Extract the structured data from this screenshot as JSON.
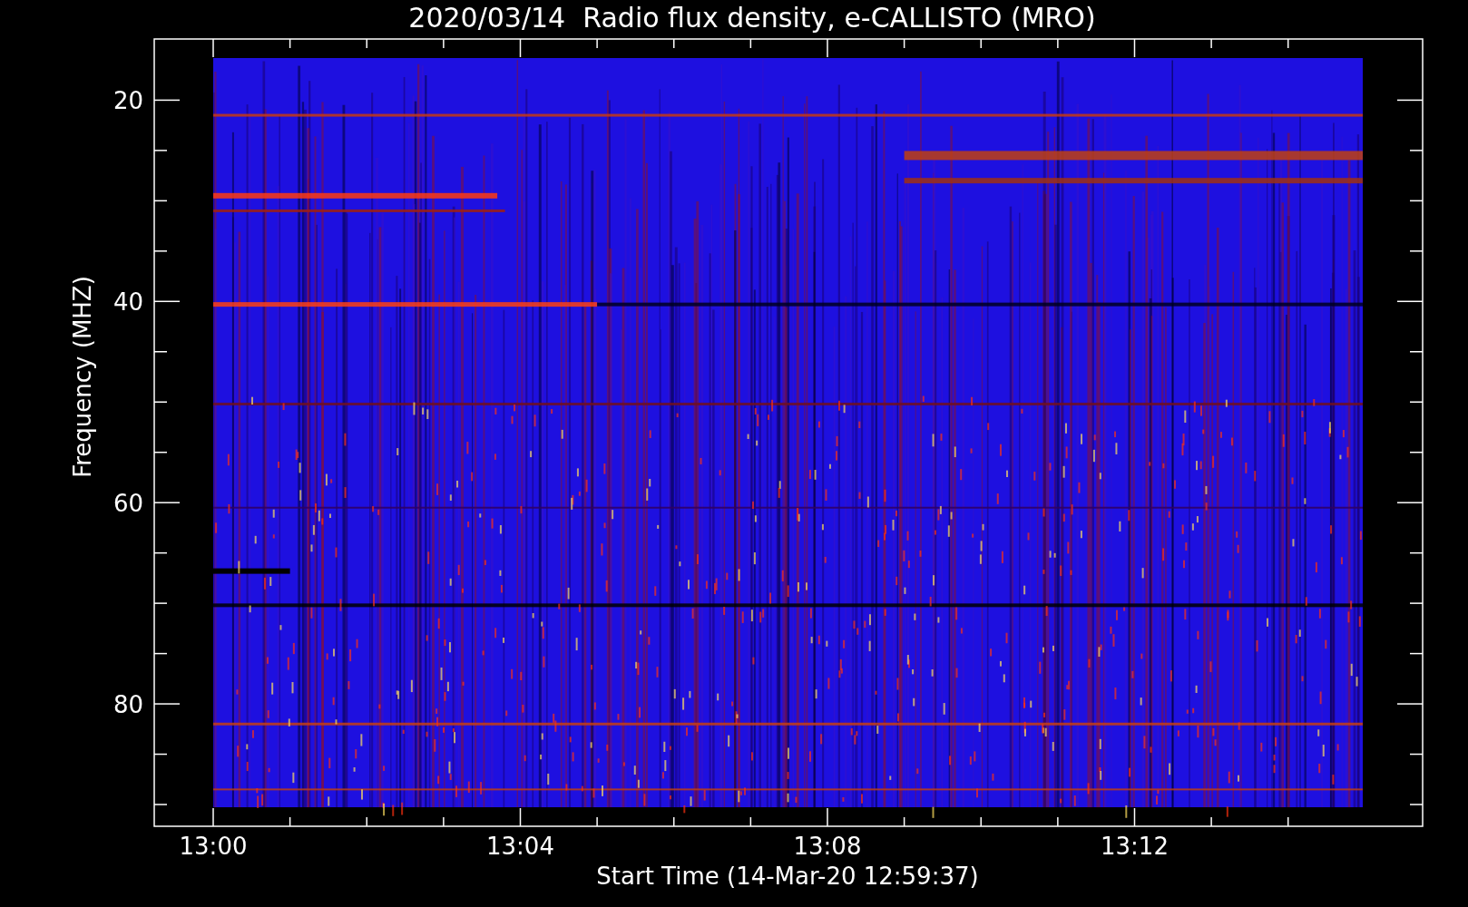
{
  "title": "2020/03/14  Radio flux density, e-CALLISTO (MRO)",
  "x_axis": {
    "label": "Start Time (14-Mar-20 12:59:37)",
    "ticks": [
      "13:00",
      "13:04",
      "13:08",
      "13:12"
    ]
  },
  "y_axis": {
    "label": "Frequency (MHZ)",
    "ticks": [
      "20",
      "40",
      "60",
      "80"
    ]
  }
}
